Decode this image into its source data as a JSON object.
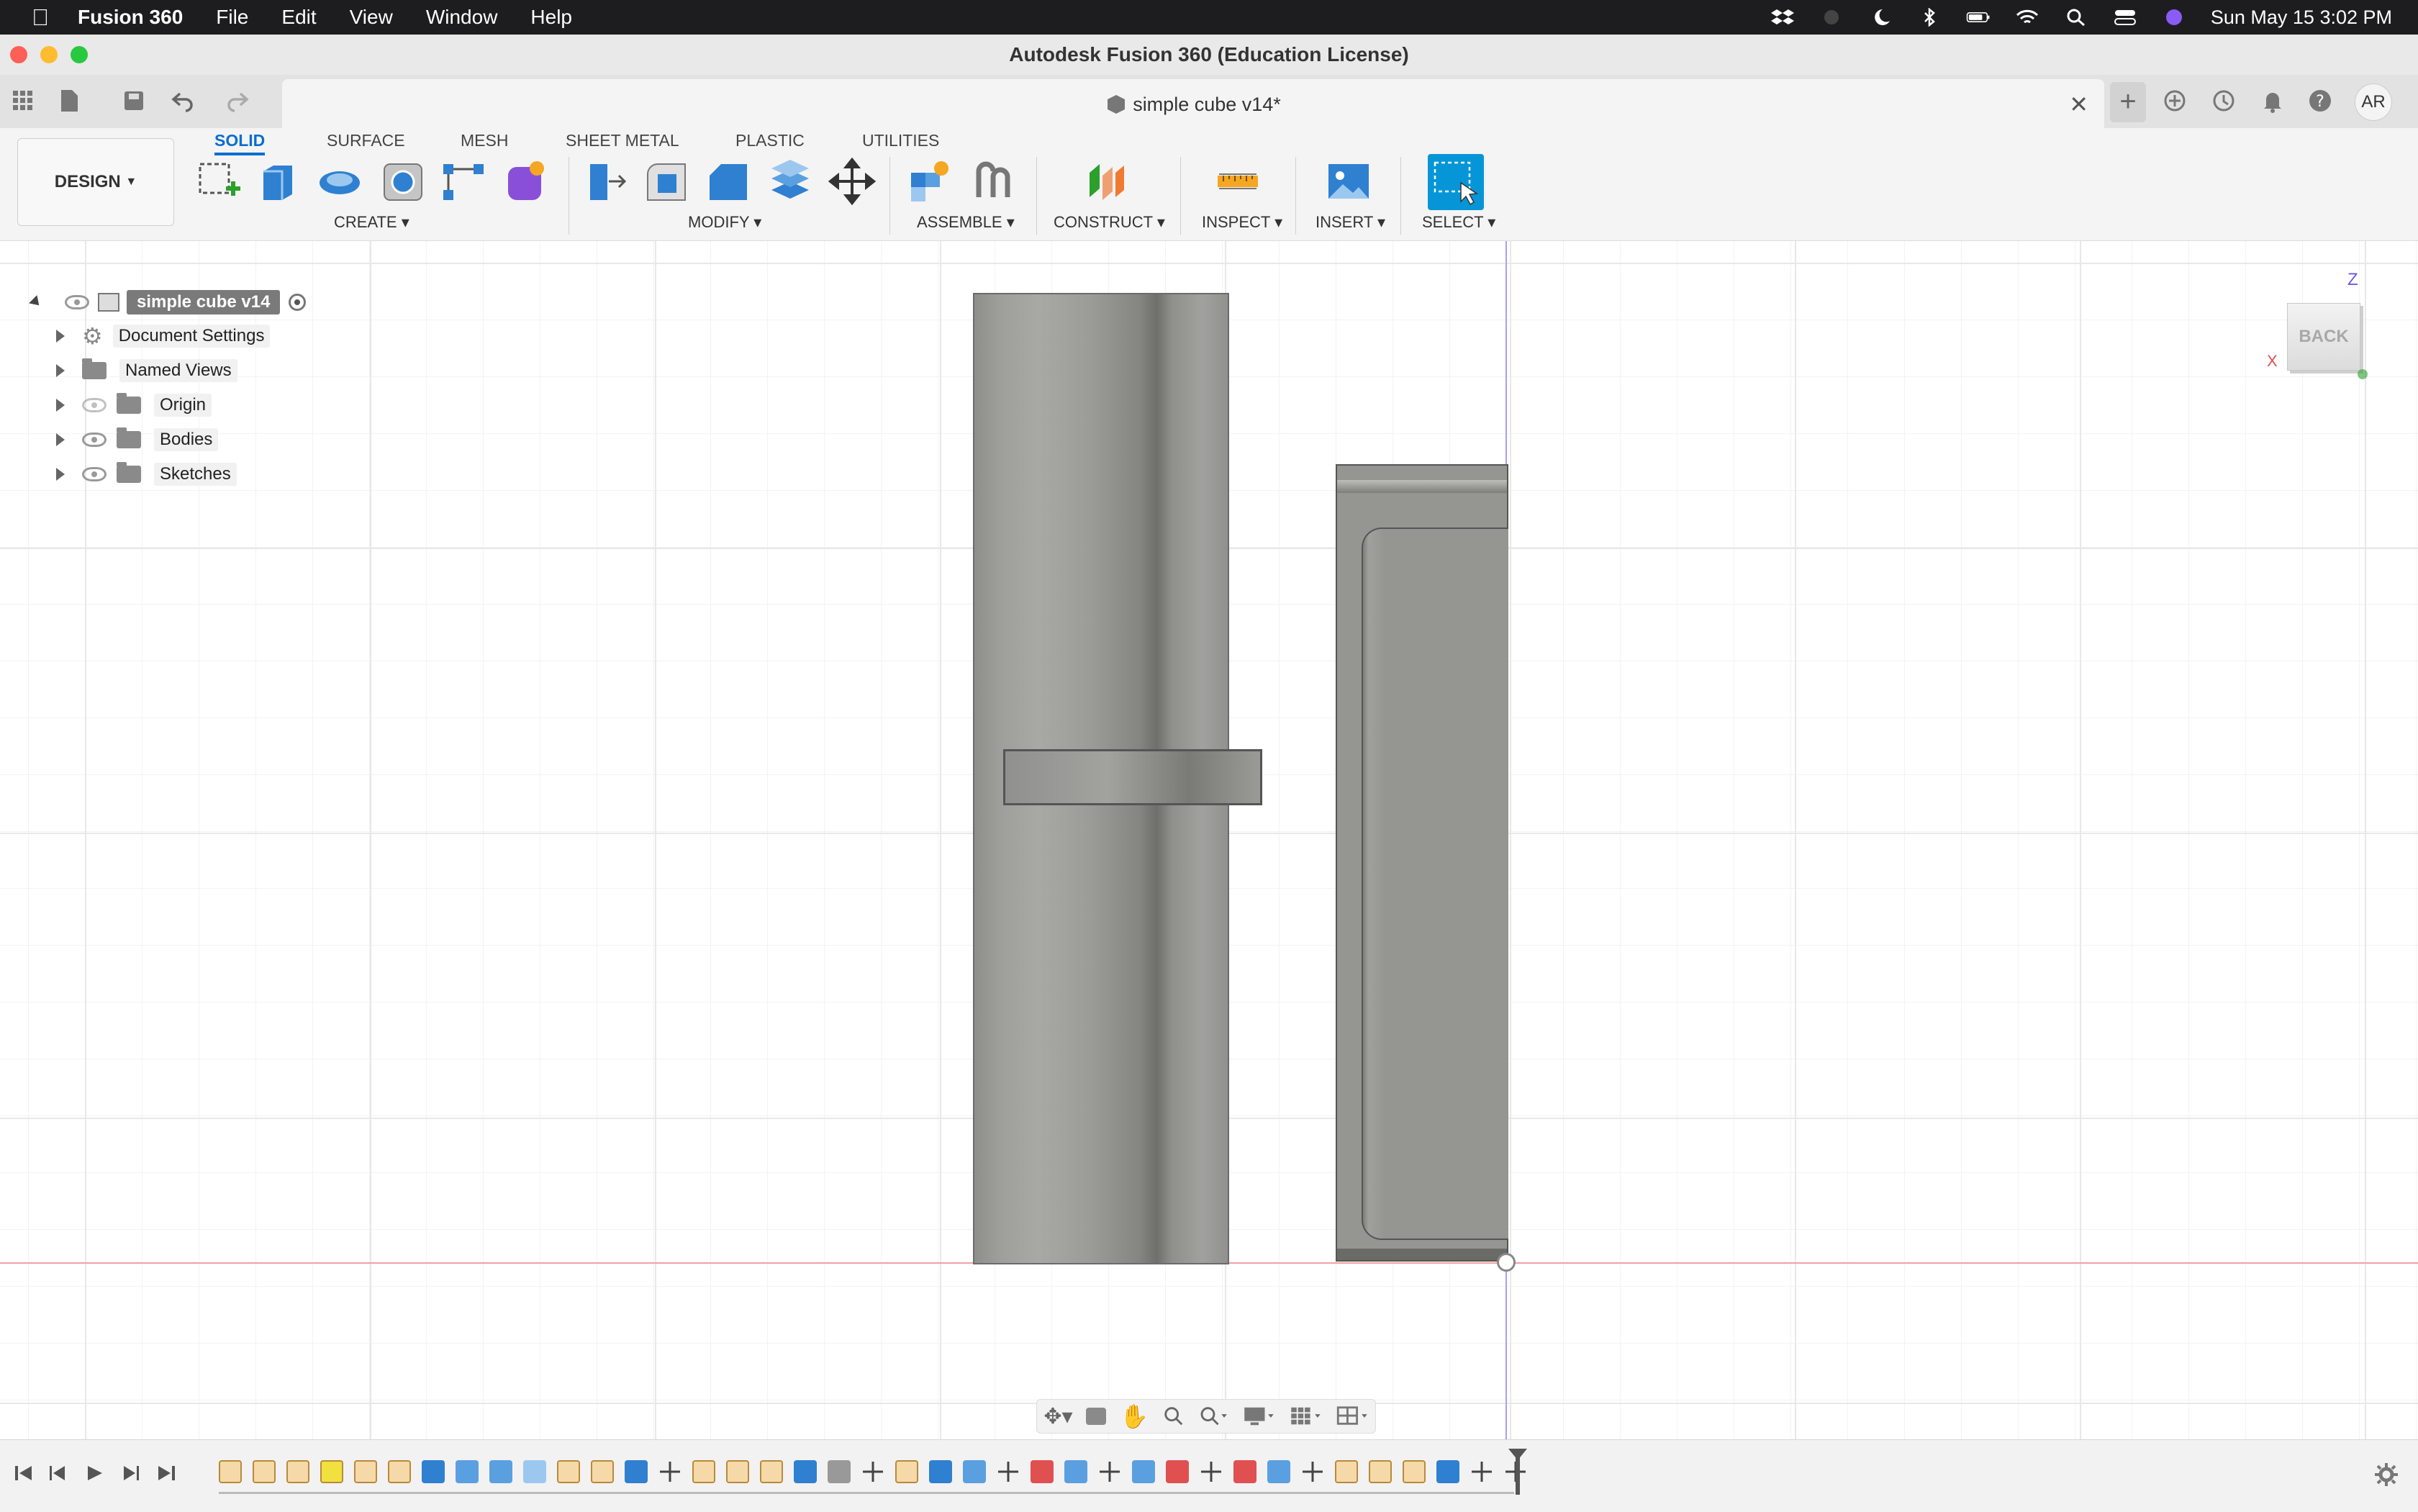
{
  "system_menubar": {
    "app_name": "Fusion 360",
    "menus": [
      "File",
      "Edit",
      "View",
      "Window",
      "Help"
    ],
    "clock": "Sun May 15  3:02 PM"
  },
  "window": {
    "title": "Autodesk Fusion 360 (Education License)"
  },
  "document_tab": {
    "label": "simple cube v14*",
    "user_initials": "AR"
  },
  "ribbon": {
    "workspace": "DESIGN",
    "tabs": [
      "SOLID",
      "SURFACE",
      "MESH",
      "SHEET METAL",
      "PLASTIC",
      "UTILITIES"
    ],
    "active_tab": "SOLID",
    "groups": [
      "CREATE",
      "MODIFY",
      "ASSEMBLE",
      "CONSTRUCT",
      "INSPECT",
      "INSERT",
      "SELECT"
    ]
  },
  "browser": {
    "root": "simple cube v14",
    "items": [
      "Document Settings",
      "Named Views",
      "Origin",
      "Bodies",
      "Sketches"
    ]
  },
  "viewcube": {
    "face": "BACK",
    "axis_z": "Z",
    "axis_x": "X"
  },
  "colors": {
    "accent": "#0a6ed1",
    "body_gray": "#9a9a96",
    "select_blue": "#0696d7"
  }
}
